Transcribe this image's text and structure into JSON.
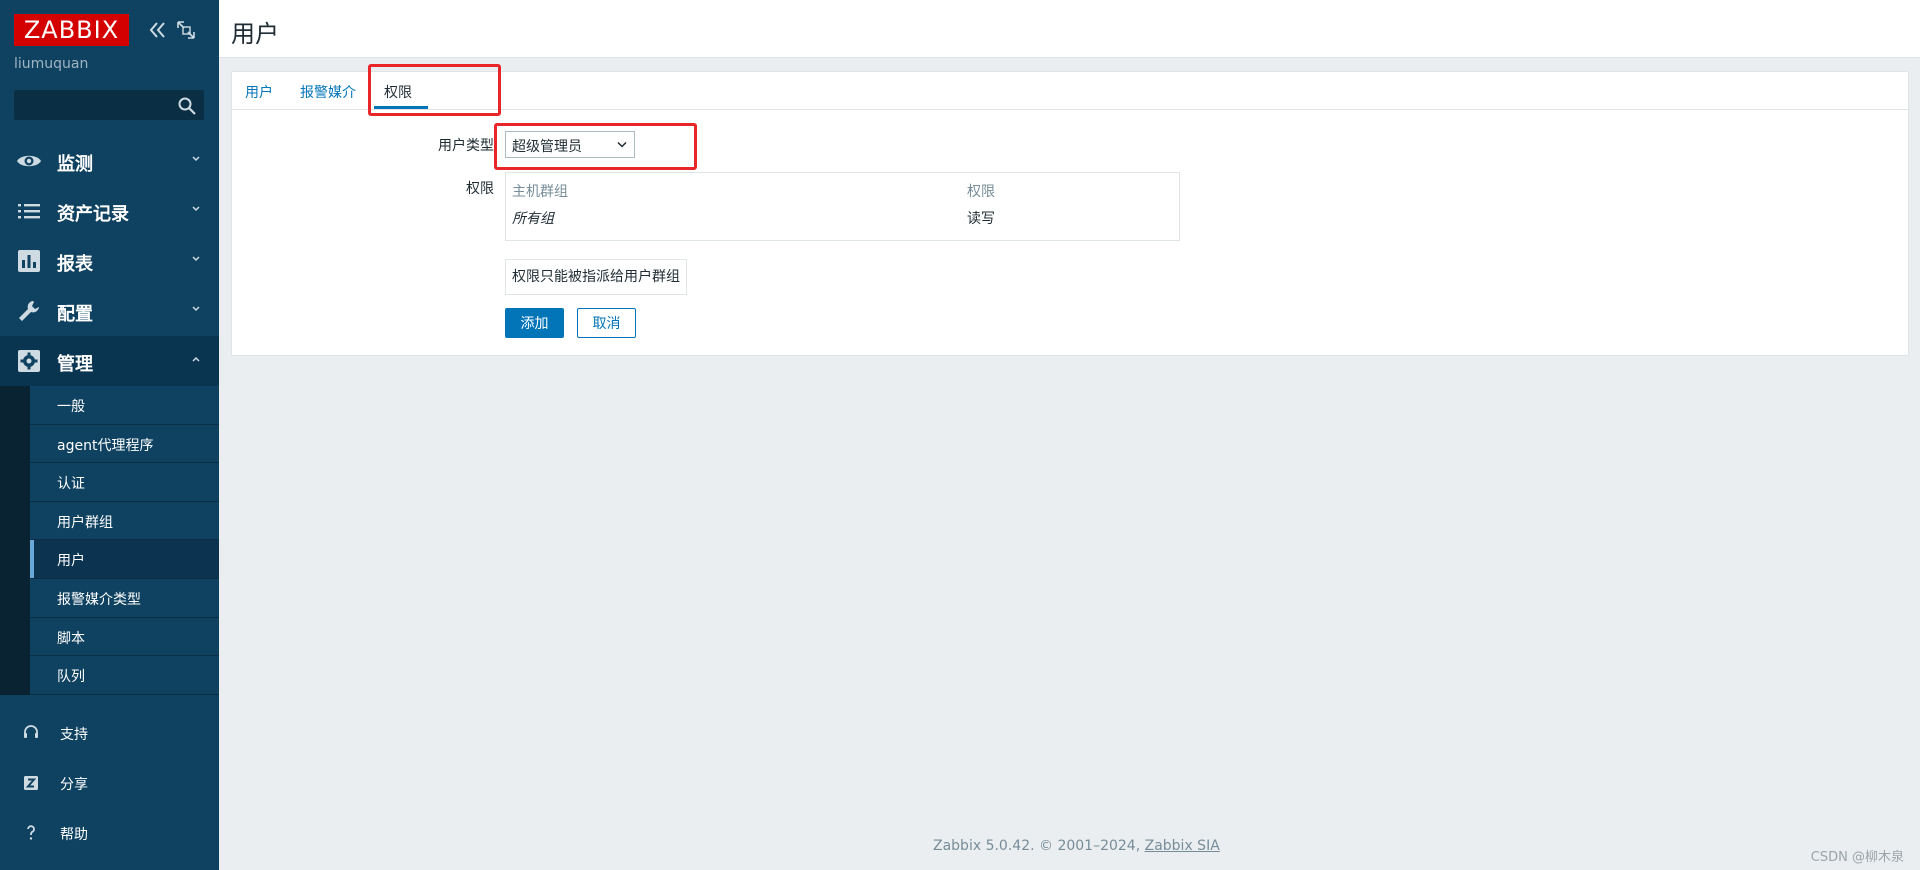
{
  "sidebar": {
    "logo": "ZABBIX",
    "username": "liumuquan",
    "search": {
      "value": "",
      "placeholder": ""
    },
    "menu": [
      {
        "label": "监测",
        "icon": "eye-icon"
      },
      {
        "label": "资产记录",
        "icon": "list-icon"
      },
      {
        "label": "报表",
        "icon": "bar-chart-icon"
      },
      {
        "label": "配置",
        "icon": "wrench-icon"
      },
      {
        "label": "管理",
        "icon": "gear-icon"
      }
    ],
    "submenu": [
      {
        "label": "一般"
      },
      {
        "label": "agent代理程序"
      },
      {
        "label": "认证"
      },
      {
        "label": "用户群组"
      },
      {
        "label": "用户"
      },
      {
        "label": "报警媒介类型"
      },
      {
        "label": "脚本"
      },
      {
        "label": "队列"
      }
    ],
    "bottom": [
      {
        "label": "支持",
        "icon": "headset-icon"
      },
      {
        "label": "分享",
        "icon": "share-icon"
      },
      {
        "label": "帮助",
        "icon": "help-icon"
      }
    ]
  },
  "header": {
    "title": "用户"
  },
  "tabs": [
    {
      "label": "用户"
    },
    {
      "label": "报警媒介"
    },
    {
      "label": "权限"
    }
  ],
  "form": {
    "user_type_label": "用户类型",
    "user_type_value": "超级管理员",
    "permissions_label": "权限",
    "table": {
      "headers": [
        "主机群组",
        "权限"
      ],
      "rows": [
        {
          "group": "所有组",
          "permission": "读写"
        }
      ]
    },
    "notice": "权限只能被指派给用户群组",
    "add_button": "添加",
    "cancel_button": "取消"
  },
  "footer": {
    "text": "Zabbix 5.0.42. © 2001–2024, ",
    "link": "Zabbix SIA"
  },
  "watermark": "CSDN @柳木泉",
  "colors": {
    "sidebar": "#0f4260",
    "logo": "#d40000",
    "accent": "#0275b8",
    "highlight": "#e8262a"
  }
}
